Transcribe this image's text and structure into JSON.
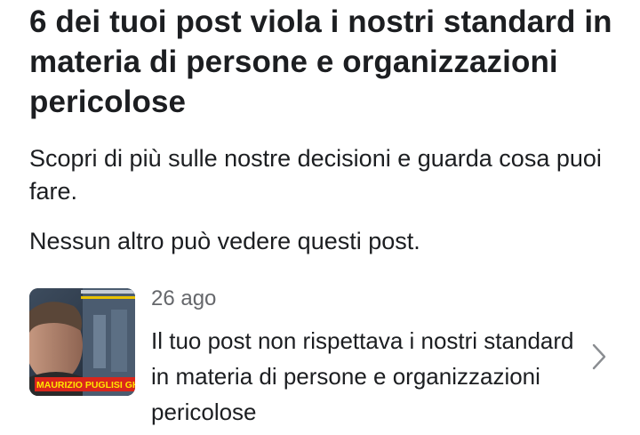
{
  "header": {
    "title": "6 dei tuoi post viola i nostri standard in materia di persone e organizzazioni pericolose",
    "subtitle": "Scopri di più sulle nostre decisioni e guarda cosa puoi fare.",
    "visibility_note": "Nessun altro può vedere questi post."
  },
  "post": {
    "date": "26 ago",
    "message": "Il tuo post non rispettava i nostri standard in materia di persone e organizzazioni pericolose",
    "thumbnail_caption": "MAURIZIO PUGLISI GH",
    "chevron_icon": "chevron-right-icon"
  },
  "colors": {
    "text_primary": "#1c1e21",
    "text_secondary": "#65676b",
    "thumbnail_banner": "#d9261c",
    "thumbnail_caption": "#ffe600"
  }
}
